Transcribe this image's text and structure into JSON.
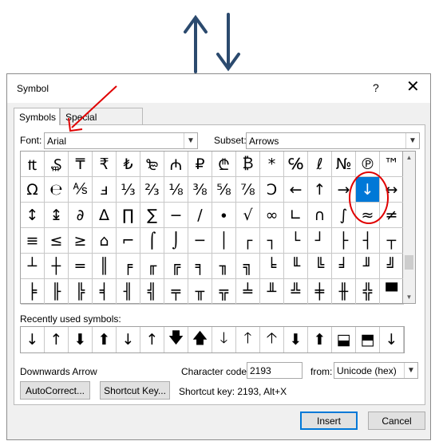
{
  "top_glyphs": {
    "left": "↑",
    "right": "↓"
  },
  "dialog": {
    "title": "Symbol",
    "help": "?",
    "close": "✕"
  },
  "tabs": [
    {
      "label": "Symbols",
      "active": true
    },
    {
      "label": "Special Characters",
      "active": false
    }
  ],
  "font": {
    "label": "Font:",
    "value": "Arial"
  },
  "subset": {
    "label": "Subset:",
    "value": "Arrows"
  },
  "grid": [
    [
      "₶",
      "₷",
      "₸",
      "₹",
      "₺",
      "₻",
      "₼",
      "₽",
      "₾",
      "₿",
      "*",
      "℅",
      "ℓ",
      "№",
      "℗",
      "™"
    ],
    [
      "Ω",
      "℮",
      "⅍",
      "ⅎ",
      "⅓",
      "⅔",
      "⅛",
      "⅜",
      "⅝",
      "⅞",
      "Ↄ",
      "←",
      "↑",
      "→",
      "↓",
      "↔"
    ],
    [
      "↕",
      "↨",
      "∂",
      "∆",
      "∏",
      "∑",
      "−",
      "∕",
      "∙",
      "√",
      "∞",
      "∟",
      "∩",
      "∫",
      "≈",
      "≠"
    ],
    [
      "≡",
      "≤",
      "≥",
      "⌂",
      "⌐",
      "⌠",
      "⌡",
      "─",
      "│",
      "┌",
      "┐",
      "└",
      "┘",
      "├",
      "┤",
      "┬"
    ],
    [
      "┴",
      "┼",
      "═",
      "║",
      "╒",
      "╓",
      "╔",
      "╕",
      "╖",
      "╗",
      "╘",
      "╙",
      "╚",
      "╛",
      "╜",
      "╝"
    ],
    [
      "╞",
      "╟",
      "╠",
      "╡",
      "╢",
      "╣",
      "╤",
      "╥",
      "╦",
      "╧",
      "╨",
      "╩",
      "╪",
      "╫",
      "╬",
      "▀"
    ]
  ],
  "selected_symbol": "↓",
  "recent": {
    "label": "Recently used symbols:",
    "symbols": [
      "↓",
      "↑",
      "⬇",
      "⬆",
      "↓",
      "↑",
      "🡇",
      "🡅",
      "🡓",
      "🡑",
      "🡡",
      "⬇",
      "⬆",
      "⬓",
      "⬒",
      "↓"
    ]
  },
  "symbol_name": "Downwards Arrow",
  "char_code": {
    "label": "Character code:",
    "value": "2193"
  },
  "from": {
    "label": "from:",
    "value": "Unicode (hex)"
  },
  "buttons": {
    "autocorrect": "AutoCorrect...",
    "shortcut_key": "Shortcut Key...",
    "insert": "Insert",
    "cancel": "Cancel"
  },
  "shortcut_text": "Shortcut key: 2193, Alt+X",
  "colors": {
    "accent": "#0078d7",
    "annotation": "#e00000",
    "arrow_glyph": "#2b4a6e"
  }
}
